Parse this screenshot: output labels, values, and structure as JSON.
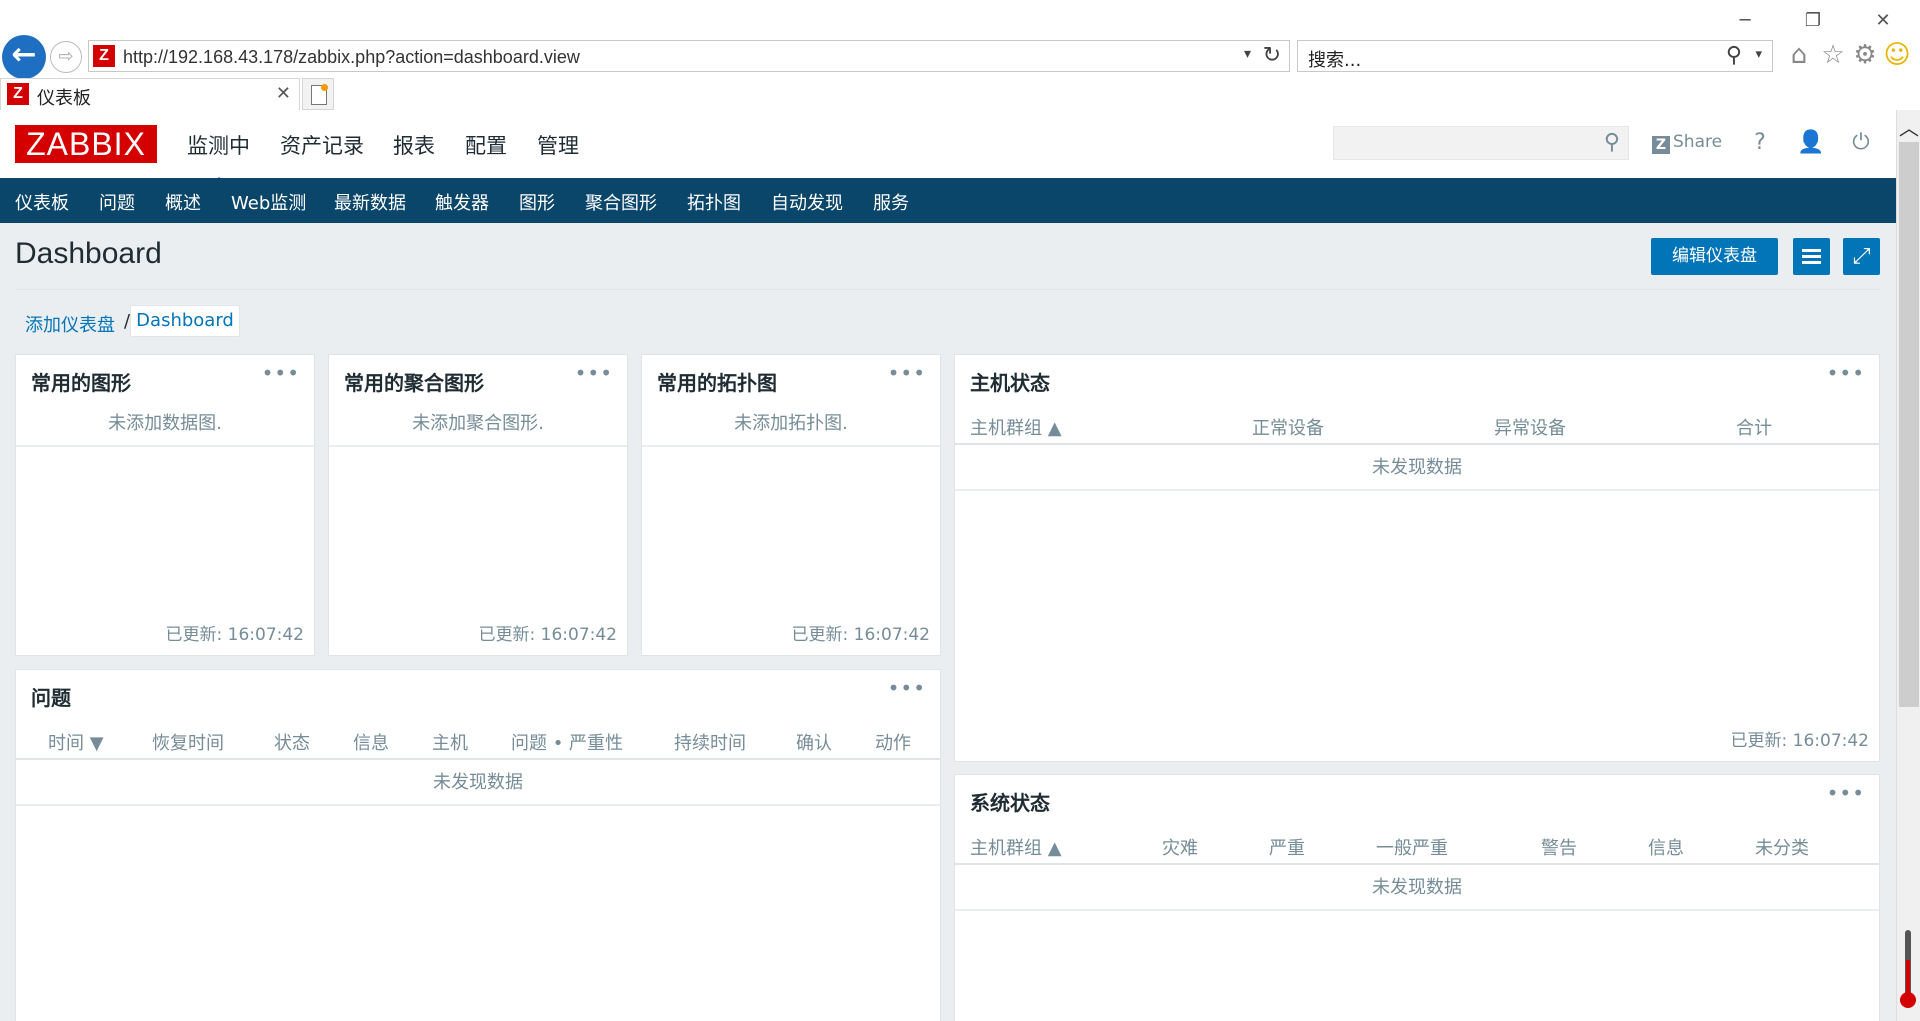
{
  "browser": {
    "address": "http://192.168.43.178/zabbix.php?action=dashboard.view",
    "search_placeholder": "搜索...",
    "tab_title": "仪表板",
    "favicon_letter": "Z"
  },
  "header": {
    "logo": "ZABBIX",
    "menu": [
      "监测中",
      "资产记录",
      "报表",
      "配置",
      "管理"
    ],
    "share_label": "Share",
    "share_icon_letter": "Z",
    "help_label": "?"
  },
  "subnav": [
    "仪表板",
    "问题",
    "概述",
    "Web监测",
    "最新数据",
    "触发器",
    "图形",
    "聚合图形",
    "拓扑图",
    "自动发现",
    "服务"
  ],
  "page": {
    "title": "Dashboard",
    "edit_button": "编辑仪表盘",
    "breadcrumb_add": "添加仪表盘",
    "breadcrumb_sep": "/",
    "breadcrumb_current": "Dashboard"
  },
  "widgets": {
    "fav_graphs": {
      "title": "常用的图形",
      "empty": "未添加数据图.",
      "updated": "已更新: 16:07:42"
    },
    "fav_screens": {
      "title": "常用的聚合图形",
      "empty": "未添加聚合图形.",
      "updated": "已更新: 16:07:42"
    },
    "fav_maps": {
      "title": "常用的拓扑图",
      "empty": "未添加拓扑图.",
      "updated": "已更新: 16:07:42"
    },
    "host_status": {
      "title": "主机状态",
      "columns": [
        "主机群组 ▲",
        "正常设备",
        "异常设备",
        "合计"
      ],
      "no_data": "未发现数据",
      "updated": "已更新: 16:07:42"
    },
    "problems": {
      "title": "问题",
      "columns": [
        "时间 ▼",
        "恢复时间",
        "状态",
        "信息",
        "主机",
        "问题 • 严重性",
        "持续时间",
        "确认",
        "动作"
      ],
      "no_data": "未发现数据"
    },
    "system_status": {
      "title": "系统状态",
      "columns": [
        "主机群组 ▲",
        "灾难",
        "严重",
        "一般严重",
        "警告",
        "信息",
        "未分类"
      ],
      "no_data": "未发现数据"
    },
    "menu_dots": "•••"
  },
  "colors": {
    "zabbix_red": "#d40000",
    "nav_dark_blue": "#0a466a",
    "button_blue": "#0275b8",
    "page_bg": "#ebeef0",
    "muted_text": "#768d99"
  },
  "icons": {
    "back": "arrow-left-icon",
    "forward": "arrow-right-icon",
    "refresh": "refresh-icon",
    "search": "search-icon",
    "home": "home-icon",
    "favorites": "star-icon",
    "settings": "gear-icon",
    "smiley": "smiley-icon",
    "user": "user-icon",
    "power": "power-icon",
    "list": "menu-icon",
    "fullscreen": "fullscreen-icon"
  }
}
